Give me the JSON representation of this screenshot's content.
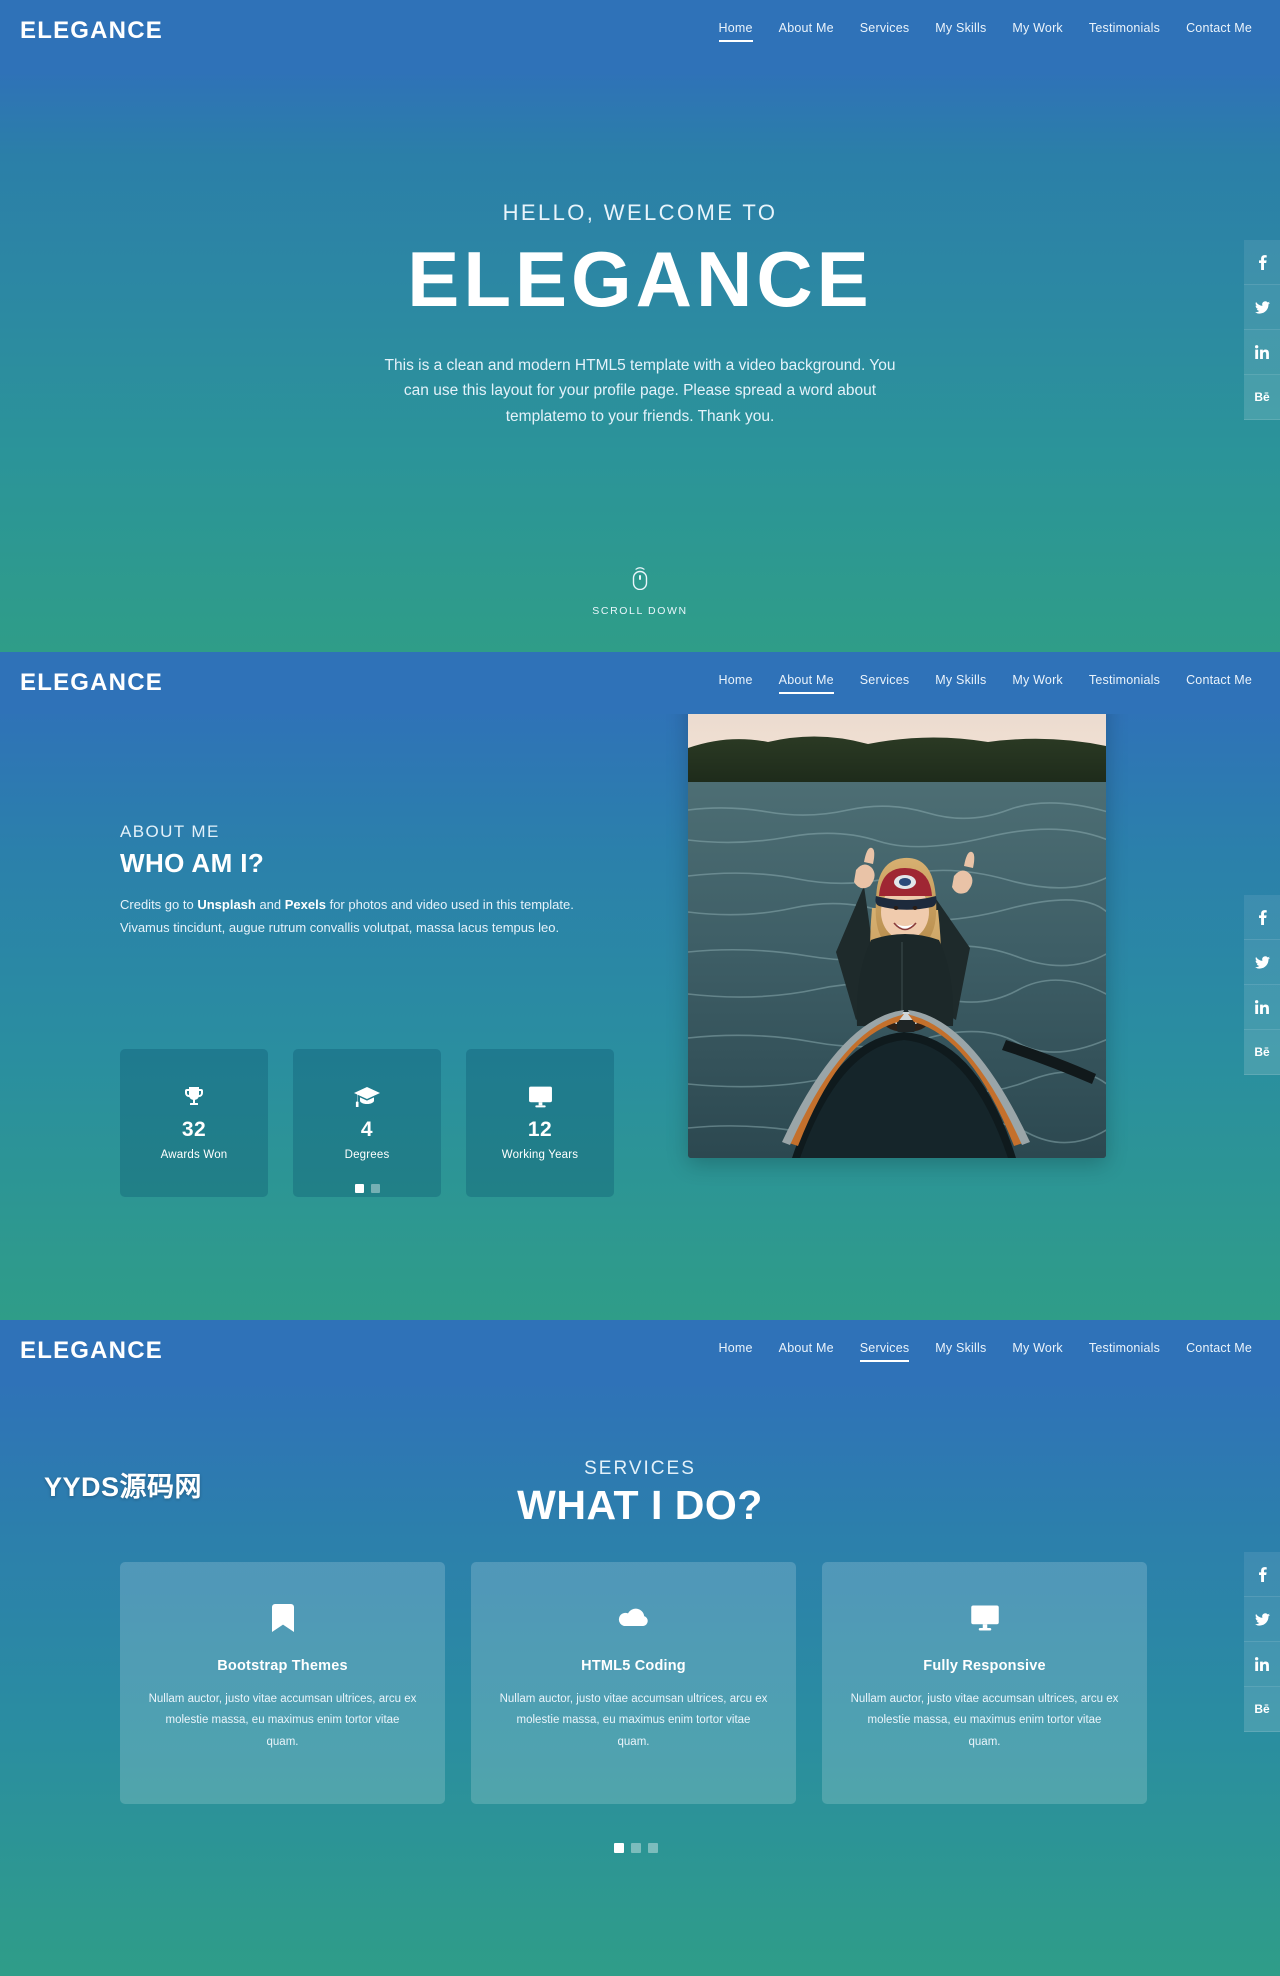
{
  "brand": "ELEGANCE",
  "nav": {
    "items": [
      "Home",
      "About Me",
      "Services",
      "My Skills",
      "My Work",
      "Testimonials",
      "Contact Me"
    ],
    "active_hero": "Home",
    "active_about": "About Me",
    "active_services": "Services"
  },
  "hero": {
    "kicker": "HELLO, WELCOME TO",
    "title": "ELEGANCE",
    "description": "This is a clean and modern HTML5 template with a video background. You can use this layout for your profile page. Please spread a word about templatemo to your friends. Thank you.",
    "scroll_label": "SCROLL DOWN",
    "mouse_icon": "mouse-scroll-icon"
  },
  "social": {
    "items": [
      {
        "name": "facebook-icon",
        "glyph": "f"
      },
      {
        "name": "twitter-icon",
        "glyph": "t"
      },
      {
        "name": "linkedin-icon",
        "glyph": "in"
      },
      {
        "name": "behance-icon",
        "glyph": "Bē"
      }
    ]
  },
  "about": {
    "kicker": "ABOUT ME",
    "title": "WHO AM I?",
    "paragraph_lead": "Credits go to ",
    "paragraph_bold_1": "Unsplash",
    "paragraph_mid": " and ",
    "paragraph_bold_2": "Pexels",
    "paragraph_tail": " for photos and video used in this template. Vivamus tincidunt, augue rutrum convallis volutpat, massa lacus tempus leo.",
    "stats": [
      {
        "icon": "trophy-icon",
        "value": "32",
        "label": "Awards Won"
      },
      {
        "icon": "graduation-cap-icon",
        "value": "4",
        "label": "Degrees"
      },
      {
        "icon": "desktop-icon",
        "value": "12",
        "label": "Working Years"
      }
    ],
    "photo_alt": "woman-in-canoe-on-lake-photo",
    "dots": {
      "count": 2,
      "active": 0
    }
  },
  "services": {
    "watermark": "YYDS源码网",
    "kicker": "SERVICES",
    "title": "WHAT I DO?",
    "cards": [
      {
        "icon": "bookmark-icon",
        "title": "Bootstrap Themes",
        "desc": "Nullam auctor, justo vitae accumsan ultrices, arcu ex molestie massa, eu maximus enim tortor vitae quam."
      },
      {
        "icon": "cloud-icon",
        "title": "HTML5 Coding",
        "desc": "Nullam auctor, justo vitae accumsan ultrices, arcu ex molestie massa, eu maximus enim tortor vitae quam."
      },
      {
        "icon": "desktop-icon",
        "title": "Fully Responsive",
        "desc": "Nullam auctor, justo vitae accumsan ultrices, arcu ex molestie massa, eu maximus enim tortor vitae quam."
      }
    ],
    "dots": {
      "count": 3,
      "active": 0
    }
  },
  "colors": {
    "nav_blue": "#2f72b8",
    "teal": "#2f9d88",
    "white": "#ffffff"
  }
}
